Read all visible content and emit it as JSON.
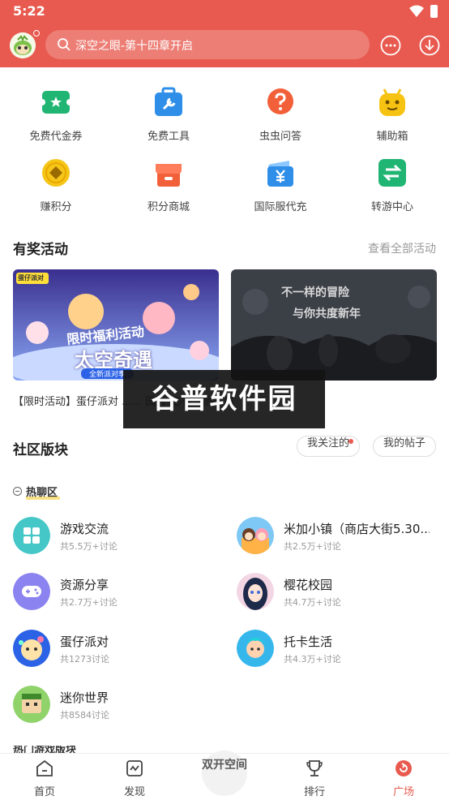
{
  "status_bar": {
    "time": "5:22"
  },
  "header": {
    "search_placeholder": "深空之眼-第十四章开启",
    "accent_color": "#e85a4f"
  },
  "shortcuts": [
    {
      "label": "免费代金券",
      "icon": "voucher-icon",
      "color": "#20b573"
    },
    {
      "label": "免费工具",
      "icon": "toolbox-icon",
      "color": "#2f8fe8"
    },
    {
      "label": "虫虫问答",
      "icon": "question-icon",
      "color": "#f2603a"
    },
    {
      "label": "辅助箱",
      "icon": "robot-icon",
      "color": "#f7c313"
    },
    {
      "label": "赚积分",
      "icon": "coin-icon",
      "color": "#f5c518"
    },
    {
      "label": "积分商城",
      "icon": "shop-icon",
      "color": "#f2603a"
    },
    {
      "label": "国际服代充",
      "icon": "yen-bag-icon",
      "color": "#2f8fe8"
    },
    {
      "label": "转游中心",
      "icon": "transfer-icon",
      "color": "#20b573"
    }
  ],
  "activities": {
    "title": "有奖活动",
    "see_all": "查看全部活动",
    "banners": [
      {
        "heading": "限时福利活动",
        "subtitle": "太空奇遇",
        "tagline": "全新派对季",
        "badge": "蛋仔派对"
      },
      {
        "heading": "不一样的冒险",
        "subtitle": "与你共度新年"
      }
    ],
    "caption": "【限时活动】蛋仔派对 ...... 园】，必得冰晶火坑"
  },
  "watermark": "谷普软件园",
  "community": {
    "title": "社区版块",
    "tabs": [
      "我关注的",
      "我的帖子"
    ],
    "hot_label": "热聊区",
    "forums": [
      {
        "name": "游戏交流",
        "count": "共5.5万+讨论",
        "icon": "grid-apps-icon"
      },
      {
        "name": "米加小镇（商店大街5.30...",
        "count": "共2.5万+讨论",
        "icon": "miga-town-icon"
      },
      {
        "name": "资源分享",
        "count": "共2.7万+讨论",
        "icon": "gamepad-icon"
      },
      {
        "name": "樱花校园",
        "count": "共4.7万+讨论",
        "icon": "sakura-school-icon"
      },
      {
        "name": "蛋仔派对",
        "count": "共1273讨论",
        "icon": "eggy-party-icon"
      },
      {
        "name": "托卡生活",
        "count": "共4.3万+讨论",
        "icon": "toca-life-icon"
      },
      {
        "name": "迷你世界",
        "count": "共8584讨论",
        "icon": "mini-world-icon"
      }
    ],
    "cut_label": "热门游戏版块"
  },
  "tabbar": {
    "tabs": [
      {
        "label": "首页",
        "icon": "home-icon"
      },
      {
        "label": "发现",
        "icon": "discover-icon"
      },
      {
        "label": "排行",
        "icon": "trophy-icon"
      },
      {
        "label": "广场",
        "icon": "plaza-icon",
        "active_color": "#e85a4f"
      }
    ],
    "center": "双开空间"
  }
}
